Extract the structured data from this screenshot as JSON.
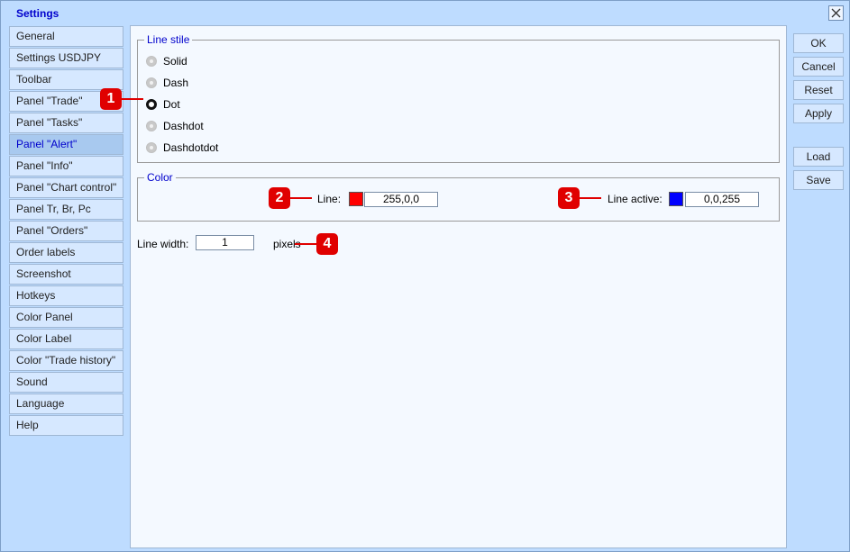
{
  "window": {
    "title": "Settings",
    "close_icon": "close-icon"
  },
  "sidebar": {
    "items": [
      {
        "label": "General"
      },
      {
        "label": "Settings USDJPY"
      },
      {
        "label": "Toolbar"
      },
      {
        "label": "Panel \"Trade\""
      },
      {
        "label": "Panel \"Tasks\""
      },
      {
        "label": "Panel \"Alert\"",
        "active": true
      },
      {
        "label": "Panel \"Info\""
      },
      {
        "label": "Panel \"Chart control\""
      },
      {
        "label": "Panel Tr, Br, Pc"
      },
      {
        "label": "Panel \"Orders\""
      },
      {
        "label": "Order labels"
      },
      {
        "label": "Screenshot"
      },
      {
        "label": "Hotkeys"
      },
      {
        "label": "Color Panel"
      },
      {
        "label": "Color Label"
      },
      {
        "label": "Color \"Trade history\""
      },
      {
        "label": "Sound"
      },
      {
        "label": "Language"
      },
      {
        "label": "Help"
      }
    ]
  },
  "line_style": {
    "legend": "Line stile",
    "options": [
      "Solid",
      "Dash",
      "Dot",
      "Dashdot",
      "Dashdotdot"
    ],
    "selected": "Dot"
  },
  "color": {
    "legend": "Color",
    "line_label": "Line:",
    "line_value": "255,0,0",
    "line_color": "#ff0000",
    "active_label": "Line active:",
    "active_value": "0,0,255",
    "active_color": "#0000ff"
  },
  "line_width": {
    "label": "Line width:",
    "value": "1",
    "unit": "pixels"
  },
  "buttons": {
    "ok": "OK",
    "cancel": "Cancel",
    "reset": "Reset",
    "apply": "Apply",
    "load": "Load",
    "save": "Save"
  },
  "callouts": [
    "1",
    "2",
    "3",
    "4"
  ],
  "colors": {
    "accent": "#0000cc",
    "window_bg": "#bedcff",
    "callout": "#e00000"
  }
}
